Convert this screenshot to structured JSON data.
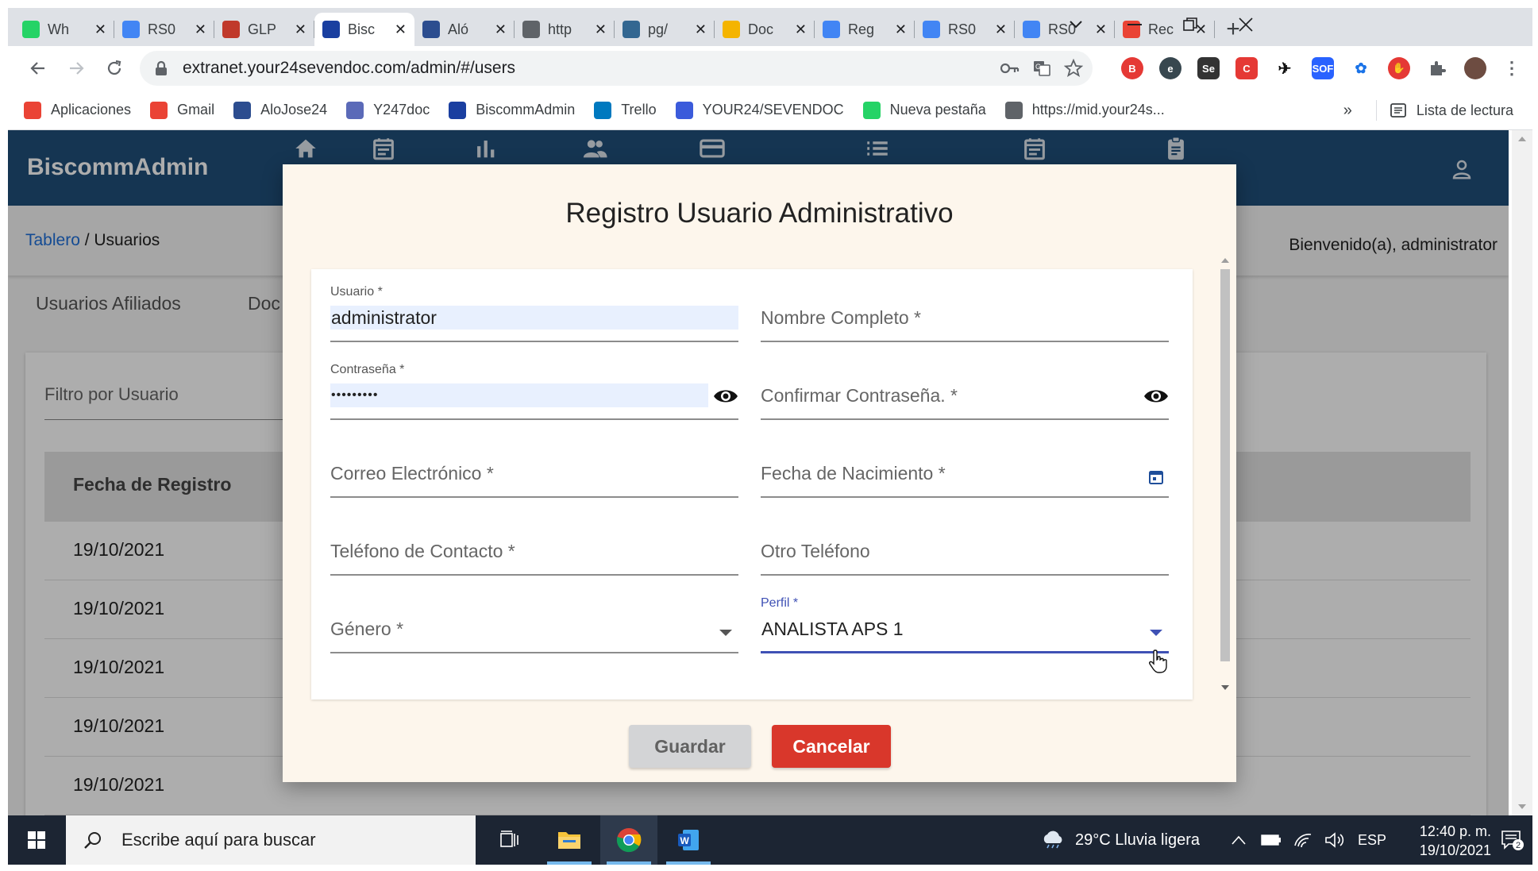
{
  "browser": {
    "tabs": [
      {
        "title": "Wh",
        "favicon_color": "#25d366",
        "favicon": "whatsapp-icon"
      },
      {
        "title": "RS0",
        "favicon_color": "#4285f4",
        "favicon": "docs-icon"
      },
      {
        "title": "GLP",
        "favicon_color": "#c0392b",
        "favicon": "glp-icon"
      },
      {
        "title": "Bisc",
        "favicon_color": "#1a3fa0",
        "favicon": "biscomm-icon",
        "active": true
      },
      {
        "title": "Aló",
        "favicon_color": "#2c4d8f",
        "favicon": "alo-icon"
      },
      {
        "title": "http",
        "favicon_color": "#5f6368",
        "favicon": "globe-icon"
      },
      {
        "title": "pg/",
        "favicon_color": "#336791",
        "favicon": "pg-icon"
      },
      {
        "title": "Doc",
        "favicon_color": "#f4b400",
        "favicon": "drive-icon"
      },
      {
        "title": "Reg",
        "favicon_color": "#4285f4",
        "favicon": "docs-icon"
      },
      {
        "title": "RS0",
        "favicon_color": "#4285f4",
        "favicon": "docs-icon"
      },
      {
        "title": "RS0",
        "favicon_color": "#4285f4",
        "favicon": "docs-icon"
      },
      {
        "title": "Rec",
        "favicon_color": "#ea4335",
        "favicon": "gmail-icon"
      }
    ],
    "url": "extranet.your24sevendoc.com/admin/#/users",
    "bookmarks": [
      {
        "label": "Aplicaciones",
        "color": "#ea4335"
      },
      {
        "label": "Gmail",
        "color": "#ea4335"
      },
      {
        "label": "AloJose24",
        "color": "#2c4d8f"
      },
      {
        "label": "Y247doc",
        "color": "#5b6ab8"
      },
      {
        "label": "BiscommAdmin",
        "color": "#1a3fa0"
      },
      {
        "label": "Trello",
        "color": "#0079bf"
      },
      {
        "label": "YOUR24/SEVENDOC",
        "color": "#3b5bdb"
      },
      {
        "label": "Nueva pestaña",
        "color": "#25d366"
      },
      {
        "label": "https://mid.your24s...",
        "color": "#5f6368"
      }
    ],
    "bookmarks_more": "»",
    "reading_list": "Lista de lectura"
  },
  "app": {
    "brand": "BiscommAdmin",
    "breadcrumb_link": "Tablero",
    "breadcrumb_current": " / Usuarios",
    "welcome": "Bienvenido(a), administrator",
    "subtabs": [
      "Usuarios Afiliados",
      "Doc"
    ],
    "filter_placeholder": "Filtro por Usuario",
    "table_header": "Fecha de Registro",
    "rows": [
      "19/10/2021",
      "19/10/2021",
      "19/10/2021",
      "19/10/2021",
      "19/10/2021"
    ]
  },
  "modal": {
    "title": "Registro Usuario Administrativo",
    "fields": {
      "usuario": {
        "label": "Usuario *",
        "value": "administrator"
      },
      "nombre": {
        "placeholder": "Nombre Completo *"
      },
      "password": {
        "label": "Contraseña *",
        "value": "•••••••••"
      },
      "confirm": {
        "placeholder": "Confirmar Contraseña. *"
      },
      "email": {
        "placeholder": "Correo Electrónico *"
      },
      "birth": {
        "placeholder": "Fecha de Nacimiento *"
      },
      "phone": {
        "placeholder": "Teléfono de Contacto *"
      },
      "phone2": {
        "placeholder": "Otro Teléfono"
      },
      "gender": {
        "placeholder": "Género *"
      },
      "perfil": {
        "label": "Perfil *",
        "value": "ANALISTA APS 1"
      }
    },
    "save_label": "Guardar",
    "cancel_label": "Cancelar"
  },
  "taskbar": {
    "search_placeholder": "Escribe aquí para buscar",
    "weather": "29°C  Lluvia ligera",
    "lang": "ESP",
    "time": "12:40 p. m.",
    "date": "19/10/2021",
    "notifications": "2"
  },
  "colors": {
    "header": "#1f4e79",
    "accent": "#3f51b5",
    "cancel": "#d9372b"
  }
}
